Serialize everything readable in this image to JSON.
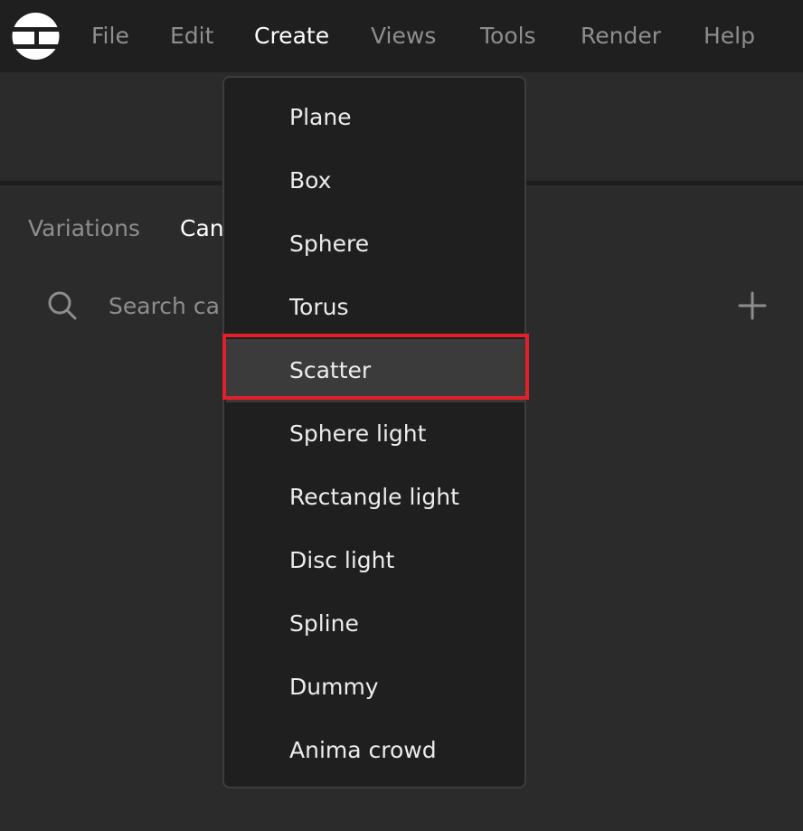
{
  "menubar": {
    "items": [
      {
        "label": "File"
      },
      {
        "label": "Edit"
      },
      {
        "label": "Create"
      },
      {
        "label": "Views"
      },
      {
        "label": "Tools"
      },
      {
        "label": "Render"
      },
      {
        "label": "Help"
      }
    ],
    "active_item": "Create"
  },
  "panel": {
    "tabs": [
      {
        "label": "Variations"
      },
      {
        "label": "Can"
      }
    ],
    "search": {
      "placeholder": "Search ca"
    }
  },
  "create_menu": {
    "items": [
      {
        "label": "Plane"
      },
      {
        "label": "Box"
      },
      {
        "label": "Sphere"
      },
      {
        "label": "Torus"
      },
      {
        "label": "Scatter"
      },
      {
        "label": "Sphere light"
      },
      {
        "label": "Rectangle light"
      },
      {
        "label": "Disc light"
      },
      {
        "label": "Spline"
      },
      {
        "label": "Dummy"
      },
      {
        "label": "Anima crowd"
      }
    ],
    "hovered_item": "Scatter"
  },
  "colors": {
    "menubar_bg": "#1f1f1f",
    "panel_bg": "#2b2b2b",
    "dropdown_bg": "#1f1f1f",
    "hover_bg": "#3b3b3b",
    "highlight_outline": "#e0202a"
  },
  "icons": {
    "logo": "app-logo-icon",
    "search": "search-icon",
    "add": "plus-icon"
  }
}
